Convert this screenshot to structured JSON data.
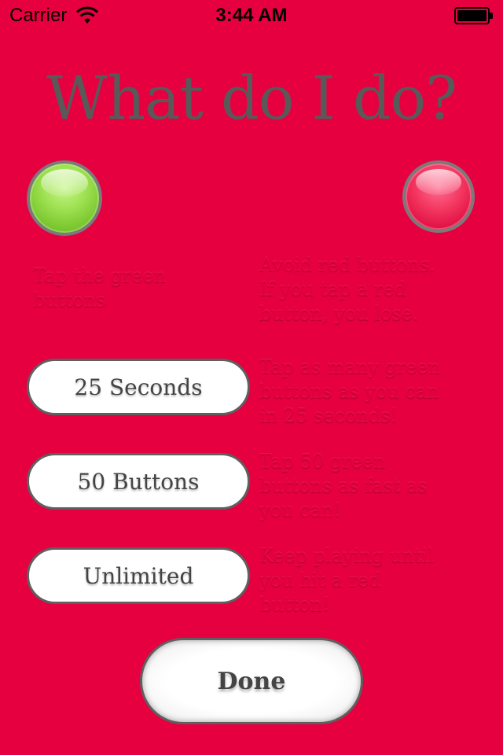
{
  "status_bar": {
    "carrier": "Carrier",
    "time": "3:44 AM",
    "icons": [
      "wifi-icon",
      "battery-icon"
    ]
  },
  "title": "What do I do?",
  "colors": {
    "background": "#e6003f",
    "title_text": "#595959",
    "button_text": "#444444",
    "button_fill": "#ffffff",
    "button_border": "#5f5f5f",
    "green_orb": "#8fd844",
    "red_orb": "#ec2a55"
  },
  "orbs": {
    "green": {
      "icon": "green-button-icon",
      "description": "Tap the green\nbuttons"
    },
    "red": {
      "icon": "red-button-icon",
      "description": "Avoid red buttons.\nIf you tap a red\nbutton, you lose."
    }
  },
  "modes": [
    {
      "label": "25 Seconds",
      "description": "Tap as many green\nbuttons as you can\nin 25 seconds!"
    },
    {
      "label": "50 Buttons",
      "description": "Tap 50 green\nbuttons as fast as\nyou can!"
    },
    {
      "label": "Unlimited",
      "description": "Keep playing until\nyou hit a red\nbutton!"
    }
  ],
  "done_label": "Done"
}
